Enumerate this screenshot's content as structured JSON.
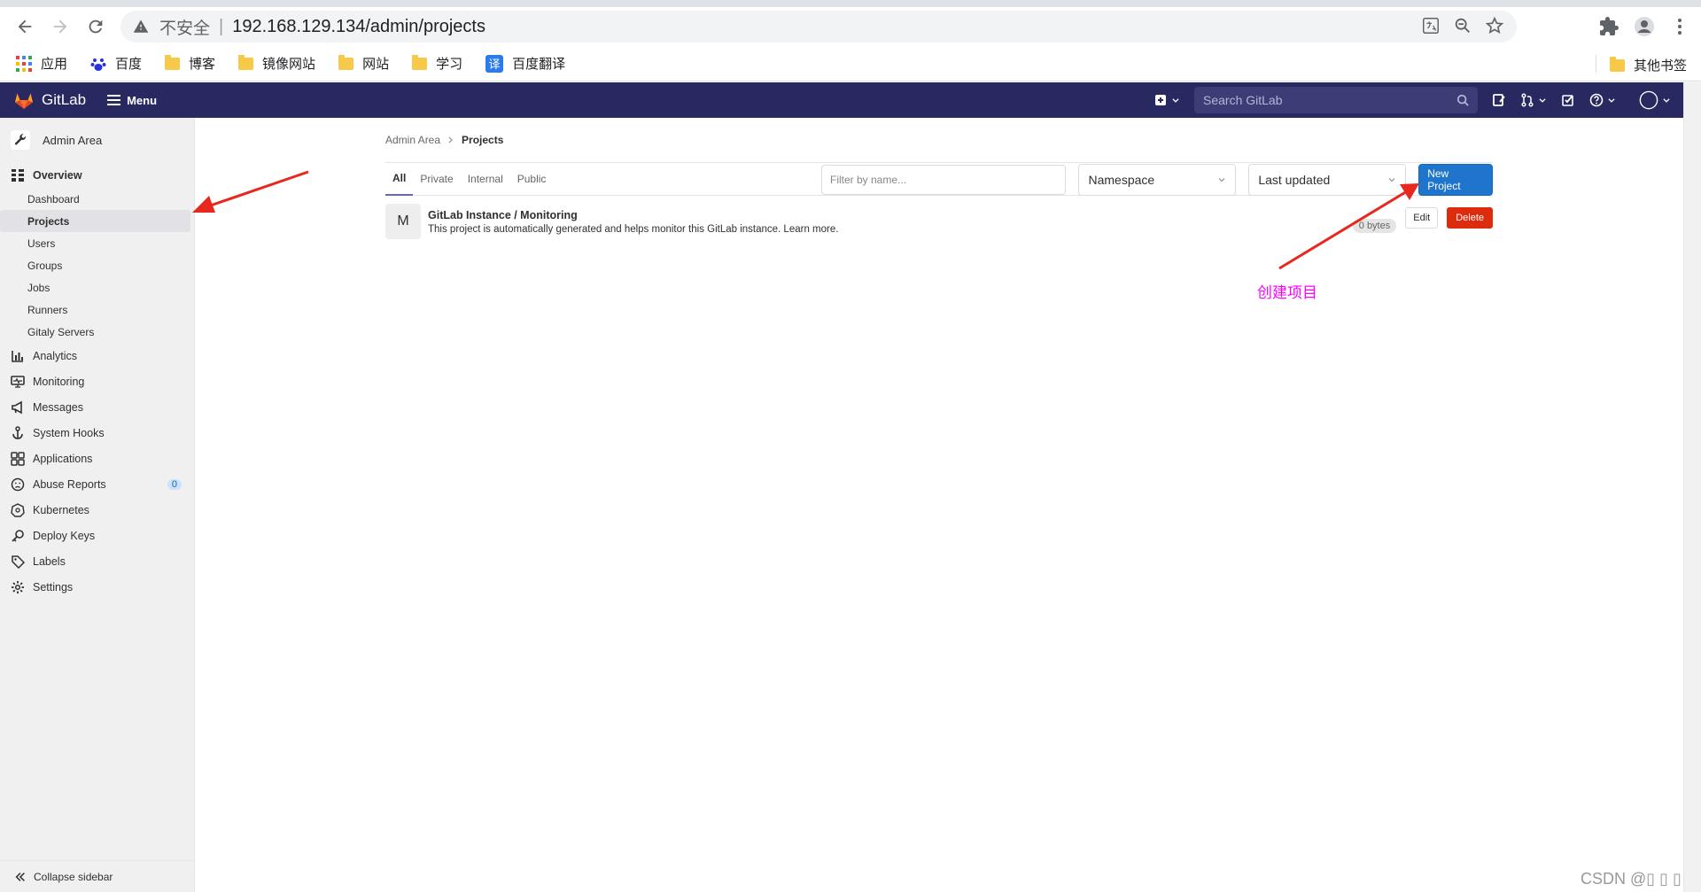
{
  "browser": {
    "insecure_label": "不安全",
    "separator": "|",
    "url": "192.168.129.134/admin/projects"
  },
  "bookmarks": {
    "items": [
      "应用",
      "百度",
      "博客",
      "镜像网站",
      "网站",
      "学习",
      "百度翻译"
    ],
    "other": "其他书签"
  },
  "header": {
    "logo": "GitLab",
    "menu": "Menu",
    "search_placeholder": "Search GitLab"
  },
  "sidebar": {
    "context": "Admin Area",
    "overview": "Overview",
    "overview_items": [
      "Dashboard",
      "Projects",
      "Users",
      "Groups",
      "Jobs",
      "Runners",
      "Gitaly Servers"
    ],
    "sections": [
      "Analytics",
      "Monitoring",
      "Messages",
      "System Hooks",
      "Applications",
      "Abuse Reports",
      "Kubernetes",
      "Deploy Keys",
      "Labels",
      "Settings"
    ],
    "abuse_count": "0",
    "collapse": "Collapse sidebar"
  },
  "breadcrumb": {
    "parent": "Admin Area",
    "current": "Projects"
  },
  "tabs": [
    "All",
    "Private",
    "Internal",
    "Public"
  ],
  "filters": {
    "filter_placeholder": "Filter by name...",
    "namespace": "Namespace",
    "sort": "Last updated",
    "new_project": "New Project"
  },
  "project": {
    "avatar_letter": "M",
    "name": "GitLab Instance / Monitoring",
    "description": "This project is automatically generated and helps monitor this GitLab instance. Learn more.",
    "size": "0 bytes",
    "edit": "Edit",
    "delete": "Delete"
  },
  "annotation": {
    "label": "创建项目",
    "color": "#ff00ff",
    "arrow_color": "#e8281e"
  },
  "watermark": "CSDN @▯ ▯ ▯"
}
